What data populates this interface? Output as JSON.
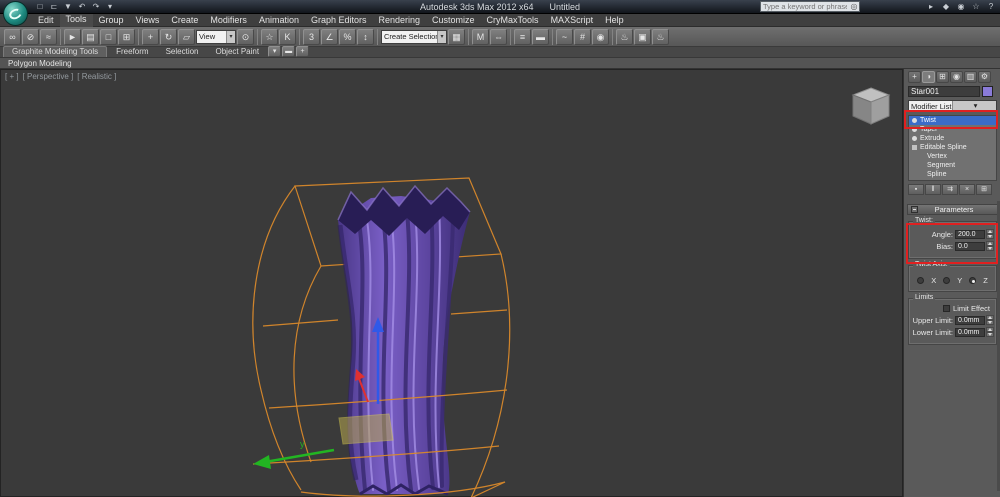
{
  "colors": {
    "selection_blue": "#3a6cc8",
    "annotation_red": "#e02020",
    "vase_purple": "#6b51b5",
    "vase_purple_dark": "#3a2b72",
    "vase_purple_deep": "#281d55",
    "vase_purple_light": "#a48ee6",
    "wire_orange": "#d9892b",
    "gizmo_x_red": "#e03030",
    "gizmo_y_green": "#22b522",
    "gizmo_z_blue": "#3059e8",
    "plane_handle_yellow": "#b8a84e",
    "object_swatch_purple": "#8a7bd8"
  },
  "title_bar": {
    "app_title": "Autodesk 3ds Max  2012 x64",
    "doc_title": "Untitled",
    "search_placeholder": "Type a keyword or phrase",
    "qat_icons": [
      {
        "name": "new-scene-icon",
        "glyph": "□"
      },
      {
        "name": "open-file-icon",
        "glyph": "⊏"
      },
      {
        "name": "save-file-icon",
        "glyph": "▼"
      },
      {
        "name": "undo-icon",
        "glyph": "↶"
      },
      {
        "name": "redo-icon",
        "glyph": "↷"
      },
      {
        "name": "qat-dropdown-icon",
        "glyph": "▾"
      }
    ],
    "infocenter_icons": [
      {
        "name": "search-go-icon",
        "glyph": "▸"
      },
      {
        "name": "subscription-center-icon",
        "glyph": "◆"
      },
      {
        "name": "communication-center-icon",
        "glyph": "◉"
      },
      {
        "name": "favorites-icon",
        "glyph": "☆"
      },
      {
        "name": "help-icon",
        "glyph": "?"
      }
    ]
  },
  "menu_bar": {
    "items": [
      "Edit",
      "Tools",
      "Group",
      "Views",
      "Create",
      "Modifiers",
      "Animation",
      "Graph Editors",
      "Rendering",
      "Customize",
      "CryMaxTools",
      "MAXScript",
      "Help"
    ],
    "highlighted": "Tools"
  },
  "toolbar": {
    "items": [
      {
        "type": "icon",
        "name": "select-and-link-icon",
        "glyph": "∞"
      },
      {
        "type": "icon",
        "name": "unlink-selection-icon",
        "glyph": "⊘"
      },
      {
        "type": "icon",
        "name": "bind-to-space-warp-icon",
        "glyph": "≈"
      },
      {
        "type": "sep"
      },
      {
        "type": "icon",
        "name": "select-object-icon",
        "glyph": "►"
      },
      {
        "type": "icon",
        "name": "select-by-name-icon",
        "glyph": "▤"
      },
      {
        "type": "icon",
        "name": "selection-region-icon",
        "glyph": "□"
      },
      {
        "type": "icon",
        "name": "window-crossing-icon",
        "glyph": "⊞"
      },
      {
        "type": "sep"
      },
      {
        "type": "icon",
        "name": "select-and-move-icon",
        "glyph": "+"
      },
      {
        "type": "icon",
        "name": "select-and-rotate-icon",
        "glyph": "↻"
      },
      {
        "type": "icon",
        "name": "select-and-scale-icon",
        "glyph": "▱"
      },
      {
        "type": "dropdown",
        "name": "reference-coordinate-dropdown",
        "label": "View",
        "width": 40
      },
      {
        "type": "icon",
        "name": "use-pivot-center-icon",
        "glyph": "⊙"
      },
      {
        "type": "sep"
      },
      {
        "type": "icon",
        "name": "select-and-manipulate-icon",
        "glyph": "☆"
      },
      {
        "type": "icon",
        "name": "keyboard-override-icon",
        "glyph": "K"
      },
      {
        "type": "sep"
      },
      {
        "type": "icon",
        "name": "snap-toggle-icon",
        "glyph": "3"
      },
      {
        "type": "icon",
        "name": "angle-snap-icon",
        "glyph": "∠"
      },
      {
        "type": "icon",
        "name": "percent-snap-icon",
        "glyph": "%"
      },
      {
        "type": "icon",
        "name": "spinner-snap-icon",
        "glyph": "↕"
      },
      {
        "type": "sep"
      },
      {
        "type": "dropdown",
        "name": "named-selection-sets-dropdown",
        "label": "Create Selection Se",
        "width": 66
      },
      {
        "type": "icon",
        "name": "edit-named-sets-icon",
        "glyph": "▦"
      },
      {
        "type": "sep"
      },
      {
        "type": "icon",
        "name": "mirror-icon",
        "glyph": "M"
      },
      {
        "type": "icon",
        "name": "align-icon",
        "glyph": "⇔"
      },
      {
        "type": "sep"
      },
      {
        "type": "icon",
        "name": "layer-manager-icon",
        "glyph": "≡"
      },
      {
        "type": "icon",
        "name": "ribbon-toggle-icon",
        "glyph": "▬"
      },
      {
        "type": "sep"
      },
      {
        "type": "icon",
        "name": "curve-editor-icon",
        "glyph": "~"
      },
      {
        "type": "icon",
        "name": "schematic-view-icon",
        "glyph": "#"
      },
      {
        "type": "icon",
        "name": "material-editor-icon",
        "glyph": "◉"
      },
      {
        "type": "sep"
      },
      {
        "type": "icon",
        "name": "render-setup-icon",
        "glyph": "♨"
      },
      {
        "type": "icon",
        "name": "rendered-frame-icon",
        "glyph": "▣"
      },
      {
        "type": "icon",
        "name": "render-production-icon",
        "glyph": "♨"
      }
    ]
  },
  "ribbon": {
    "tabs": [
      {
        "label": "Graphite Modeling Tools",
        "active": true
      },
      {
        "label": "Freeform",
        "active": false
      },
      {
        "label": "Selection",
        "active": false
      },
      {
        "label": "Object Paint",
        "active": false
      }
    ],
    "extra_icons": [
      {
        "name": "ribbon-options-icon",
        "glyph": "▾"
      },
      {
        "name": "ribbon-minimize-icon",
        "glyph": "▬"
      },
      {
        "name": "ribbon-add-icon",
        "glyph": "+"
      }
    ],
    "subtab": "Polygon Modeling"
  },
  "viewport": {
    "menus": [
      {
        "name": "viewport-general-menu",
        "label": "[ + ]"
      },
      {
        "name": "viewport-pov-menu",
        "label": "[ Perspective ]"
      },
      {
        "name": "viewport-shading-menu",
        "label": "[ Realistic ]"
      }
    ],
    "axis_label": "y"
  },
  "command_panel": {
    "tabs": [
      {
        "name": "create-tab-icon",
        "glyph": "+",
        "active": false
      },
      {
        "name": "modify-tab-icon",
        "glyph": "◑",
        "active": true
      },
      {
        "name": "hierarchy-tab-icon",
        "glyph": "⊞",
        "active": false
      },
      {
        "name": "motion-tab-icon",
        "glyph": "◉",
        "active": false
      },
      {
        "name": "display-tab-icon",
        "glyph": "▥",
        "active": false
      },
      {
        "name": "utilities-tab-icon",
        "glyph": "⚙",
        "active": false
      }
    ],
    "object_name": "Star001",
    "modifier_list_label": "Modifier List",
    "stack": [
      {
        "label": "Twist",
        "bulb": true,
        "selected": true
      },
      {
        "label": "Taper",
        "bulb": true
      },
      {
        "label": "Extrude",
        "bulb": true
      },
      {
        "label": "Editable Spline",
        "square": true
      },
      {
        "label": "Vertex",
        "child": true
      },
      {
        "label": "Segment",
        "child": true
      },
      {
        "label": "Spline",
        "child": true
      }
    ],
    "stack_buttons": [
      {
        "name": "pin-stack-icon",
        "glyph": "▪"
      },
      {
        "name": "show-end-result-icon",
        "glyph": "‖"
      },
      {
        "name": "make-unique-icon",
        "glyph": "⇉"
      },
      {
        "name": "remove-modifier-icon",
        "glyph": "×"
      },
      {
        "name": "configure-modifier-sets-icon",
        "glyph": "⊞"
      }
    ],
    "parameters": {
      "rollout_title": "Parameters",
      "groups": {
        "twist": {
          "legend": "Twist:",
          "rows": [
            {
              "label": "Angle:",
              "value": "200.0"
            },
            {
              "label": "Bias:",
              "value": "0.0"
            }
          ]
        },
        "axis": {
          "legend": "Twist Axis:",
          "options": [
            "X",
            "Y",
            "Z"
          ],
          "selected": "Z"
        },
        "limits": {
          "legend": "Limits",
          "checkbox": "Limit Effect",
          "checked": false,
          "rows": [
            {
              "label": "Upper Limit:",
              "value": "0.0mm"
            },
            {
              "label": "Lower Limit:",
              "value": "0.0mm"
            }
          ]
        }
      }
    }
  }
}
